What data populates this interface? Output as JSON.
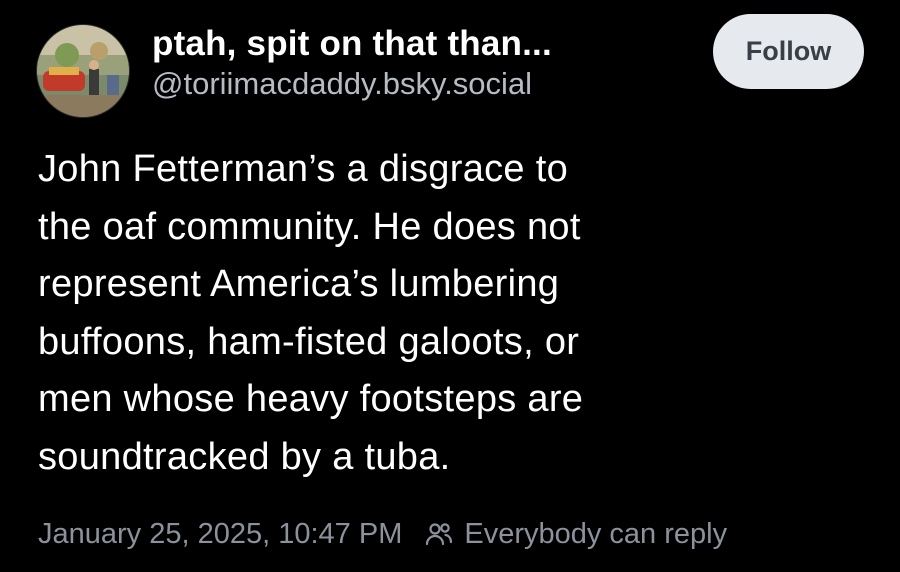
{
  "post": {
    "author": {
      "display_name": "ptah, spit on that than...",
      "handle": "@toriimacdaddy.bsky.social",
      "avatar_icon": "avatar-image"
    },
    "follow_button": {
      "label": "Follow"
    },
    "text_lines": [
      "John Fetterman’s a disgrace to",
      "the oaf community. He does not",
      "represent America’s lumbering",
      "buffoons, ham-fisted galoots, or",
      "men whose heavy footsteps are",
      "soundtracked by a tuba."
    ],
    "timestamp": "January 25, 2025, 10:47 PM",
    "reply_setting": {
      "icon": "people-icon",
      "label": "Everybody can reply"
    }
  },
  "colors": {
    "background": "#000000",
    "text_primary": "#ffffff",
    "text_secondary": "#b6bcc4",
    "text_meta": "#8b929c",
    "button_bg": "#e6e9ee",
    "button_text": "#3a3f47"
  }
}
